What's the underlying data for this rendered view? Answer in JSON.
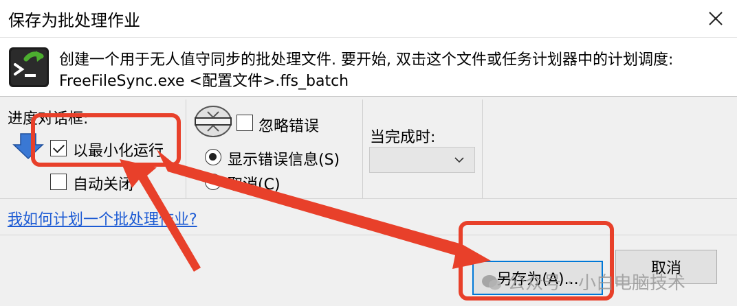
{
  "window": {
    "title": "保存为批处理作业"
  },
  "info": {
    "line1": "创建一个用于无人值守同步的批处理文件. 要开始, 双击这个文件或任务计划器中的计划调度:",
    "line2": "FreeFileSync.exe <配置文件>.ffs_batch"
  },
  "progress_dialog": {
    "label": "进度对话框:",
    "run_minimized": {
      "label": "以最小化运行",
      "checked": true
    },
    "auto_close": {
      "label": "自动关闭",
      "checked": false
    }
  },
  "errors": {
    "ignore_errors": {
      "label": "忽略错误",
      "checked": false
    },
    "show_error_message": {
      "label": "显示错误信息(S)",
      "selected": true
    },
    "cancel": {
      "label": "取消(C)",
      "selected": false
    }
  },
  "on_completion": {
    "label": "当完成时:",
    "value": ""
  },
  "help_link": "我如何计划一个批处理作业?",
  "buttons": {
    "save_as": "另存为(A)...",
    "cancel": "取消"
  },
  "watermark": "公众号 · 小白电脑技术",
  "colors": {
    "annotation": "#e8402a",
    "link": "#1d5bd4",
    "focus": "#0078d7"
  },
  "icons": [
    "close-icon",
    "freefilesync-batch-icon",
    "minimize-arrow-icon",
    "error-handling-icon",
    "chevron-down-icon",
    "wechat-icon"
  ]
}
